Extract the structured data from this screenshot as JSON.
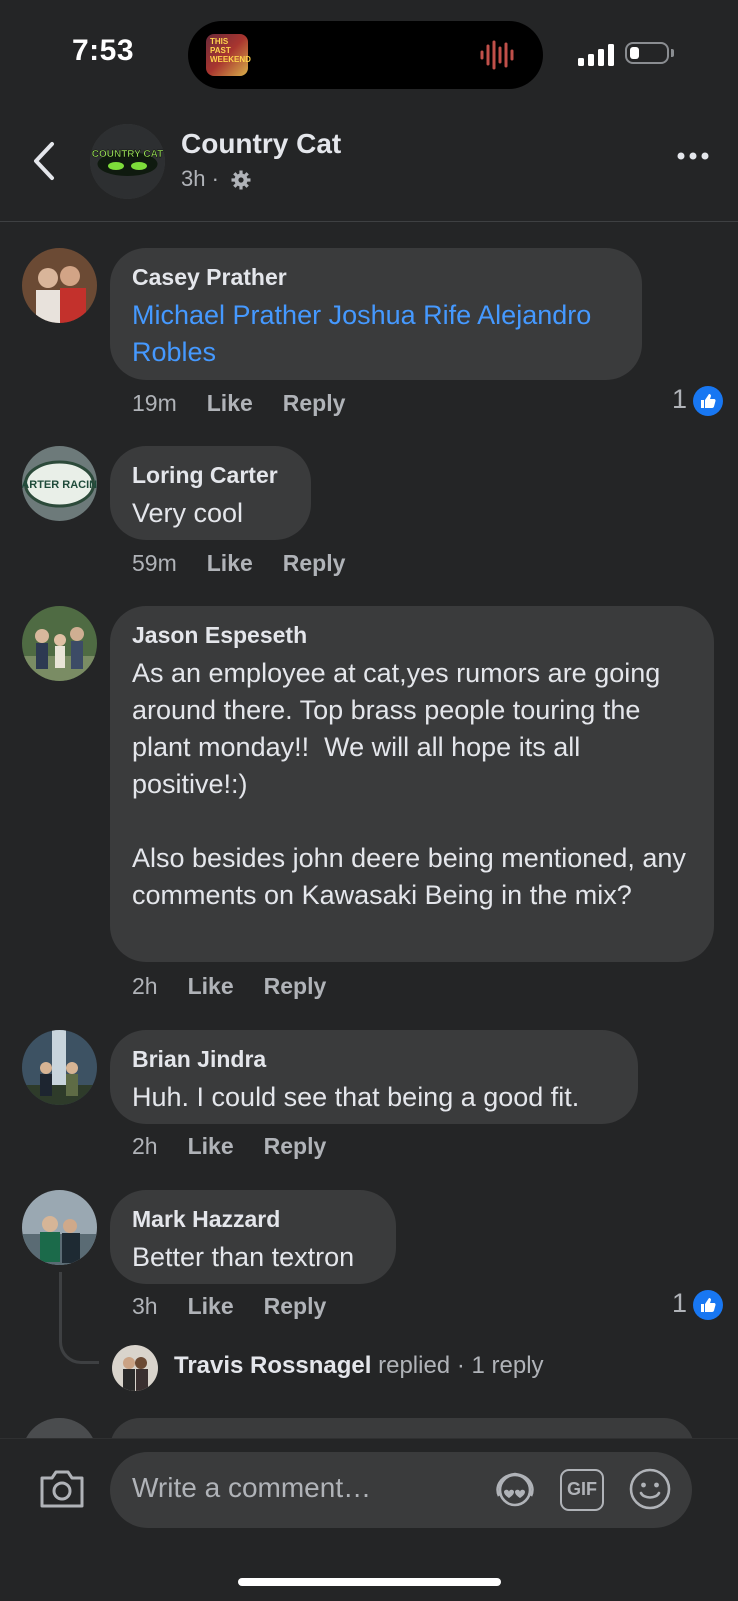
{
  "status_bar": {
    "time": "7:53",
    "album_art_text": "THIS PAST WEEKEND"
  },
  "header": {
    "page_name": "Country Cat",
    "age": "3h ·",
    "avatar_logo_text": "COUNTRY CAT"
  },
  "comments": [
    {
      "author": "Casey Prather",
      "mentions": "Michael Prather Joshua Rife Alejandro Robles",
      "time": "19m",
      "like": "Like",
      "reply": "Reply",
      "reaction_count": "1"
    },
    {
      "author": "Loring Carter",
      "text": "Very cool",
      "time": "59m",
      "like": "Like",
      "reply": "Reply",
      "avatar_logo_text": "CARTER RACING"
    },
    {
      "author": "Jason Espeseth",
      "text": "As an employee at cat,yes rumors are going around there. Top brass people touring the plant monday!!  We will all hope its all positive!:)\n\nAlso besides john deere being mentioned, any comments on Kawasaki Being in the mix?",
      "time": "2h",
      "like": "Like",
      "reply": "Reply"
    },
    {
      "author": "Brian Jindra",
      "text": "Huh. I could see that being a good fit.",
      "time": "2h",
      "like": "Like",
      "reply": "Reply"
    },
    {
      "author": "Mark Hazzard",
      "text": "Better than textron",
      "time": "3h",
      "like": "Like",
      "reply": "Reply",
      "reaction_count": "1"
    }
  ],
  "reply_summary": {
    "name": "Travis Rossnagel",
    "action": "replied",
    "count": "· 1 reply"
  },
  "composer": {
    "placeholder": "Write a comment…",
    "gif_label": "GIF"
  },
  "colors": {
    "background": "#242526",
    "bubble": "#3a3b3c",
    "mention": "#4599ff",
    "like_blue": "#1877f2",
    "secondary_text": "#b0b3b8"
  },
  "icons": [
    "back-chevron-icon",
    "gear-icon",
    "more-icon",
    "like-icon",
    "camera-icon",
    "avatar-sticker-icon",
    "gif-icon",
    "emoji-icon",
    "signal-icon",
    "battery-icon",
    "waveform-icon"
  ]
}
